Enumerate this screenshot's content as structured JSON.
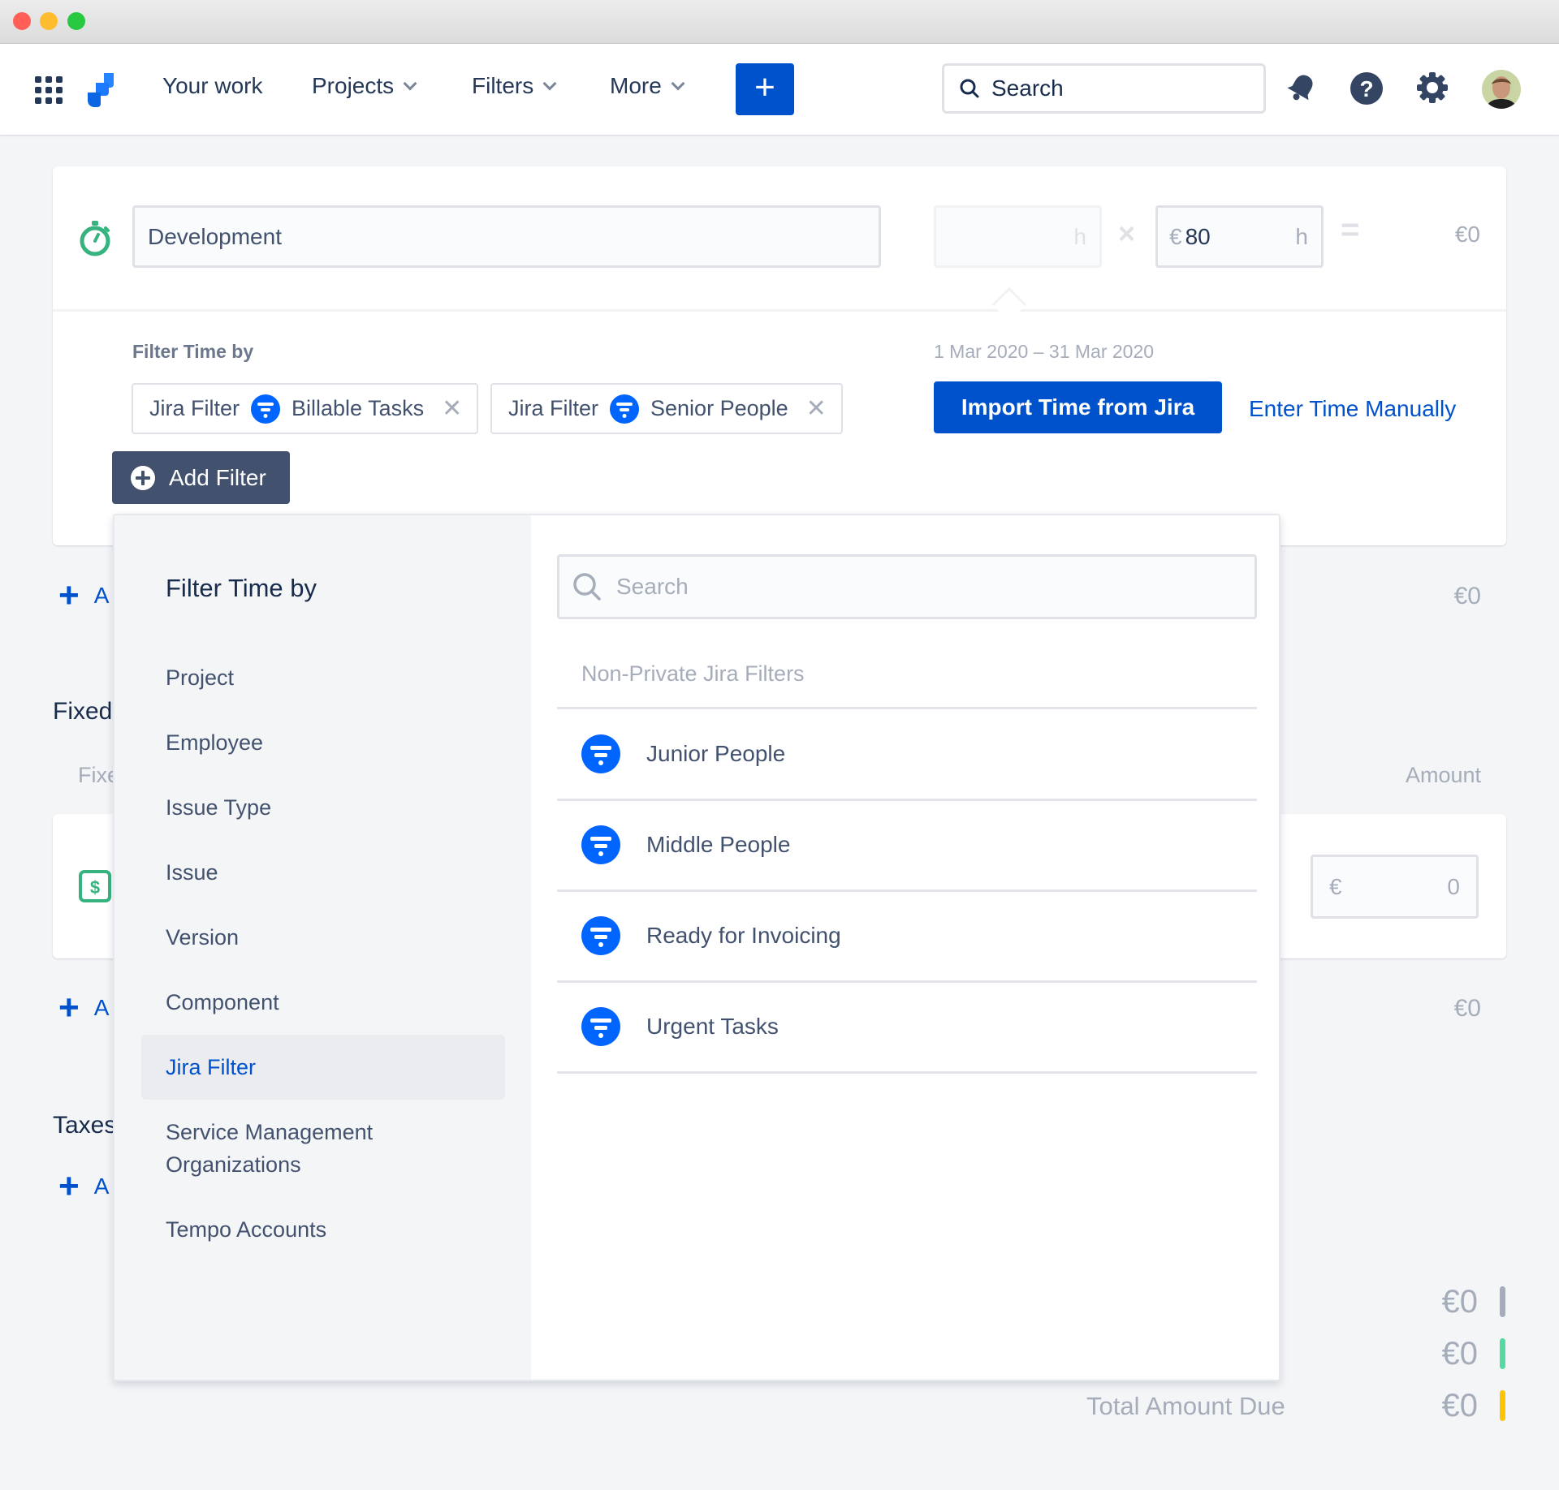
{
  "window": {
    "traffic_lights": [
      {
        "name": "close",
        "color": "#ff5f57"
      },
      {
        "name": "minimize",
        "color": "#febc2e"
      },
      {
        "name": "maximize",
        "color": "#28c840"
      }
    ]
  },
  "nav": {
    "items": [
      {
        "label": "Your work",
        "has_chevron": false
      },
      {
        "label": "Projects",
        "has_chevron": true
      },
      {
        "label": "Filters",
        "has_chevron": true
      },
      {
        "label": "More",
        "has_chevron": true
      }
    ],
    "create_label": "+",
    "search_placeholder": "Search",
    "accent": "#0052cc"
  },
  "time_entry": {
    "description": "Development",
    "hours_value": "",
    "hours_unit": "h",
    "multiply_sign": "×",
    "rate_currency": "€",
    "rate_value": "80",
    "rate_unit": "h",
    "equals_sign": "=",
    "total": "€0"
  },
  "filter_section": {
    "label": "Filter Time by",
    "date_range": "1 Mar 2020 – 31 Mar 2020",
    "chips": [
      {
        "type": "Jira Filter",
        "value": "Billable Tasks"
      },
      {
        "type": "Jira Filter",
        "value": "Senior People"
      }
    ],
    "add_filter_label": "Add Filter",
    "import_button": "Import Time from Jira",
    "manual_link": "Enter Time Manually"
  },
  "background": {
    "add_row_label": "A",
    "row_total": "€0",
    "fixed_title": "Fixed",
    "fixed_col_label": "Fixe",
    "amount_header": "Amount",
    "fixed_amount_currency": "€",
    "fixed_amount_value": "0",
    "fixed_total": "€0",
    "taxes_title": "Taxes",
    "summary": [
      {
        "label": "",
        "value": "€0",
        "color": "#a5adba"
      },
      {
        "label": "",
        "value": "€0",
        "color": "#57d9a3"
      },
      {
        "label": "Total Amount Due",
        "value": "€0",
        "color": "#ffc400"
      }
    ]
  },
  "dropdown": {
    "title": "Filter Time by",
    "categories": [
      {
        "label": "Project",
        "active": false
      },
      {
        "label": "Employee",
        "active": false
      },
      {
        "label": "Issue Type",
        "active": false
      },
      {
        "label": "Issue",
        "active": false
      },
      {
        "label": "Version",
        "active": false
      },
      {
        "label": "Component",
        "active": false
      },
      {
        "label": "Jira Filter",
        "active": true
      },
      {
        "label": "Service Management Organizations",
        "active": false
      },
      {
        "label": "Tempo Accounts",
        "active": false
      }
    ],
    "search_placeholder": "Search",
    "section_label": "Non-Private Jira Filters",
    "filters": [
      "Junior People",
      "Middle People",
      "Ready for Invoicing",
      "Urgent Tasks"
    ]
  }
}
